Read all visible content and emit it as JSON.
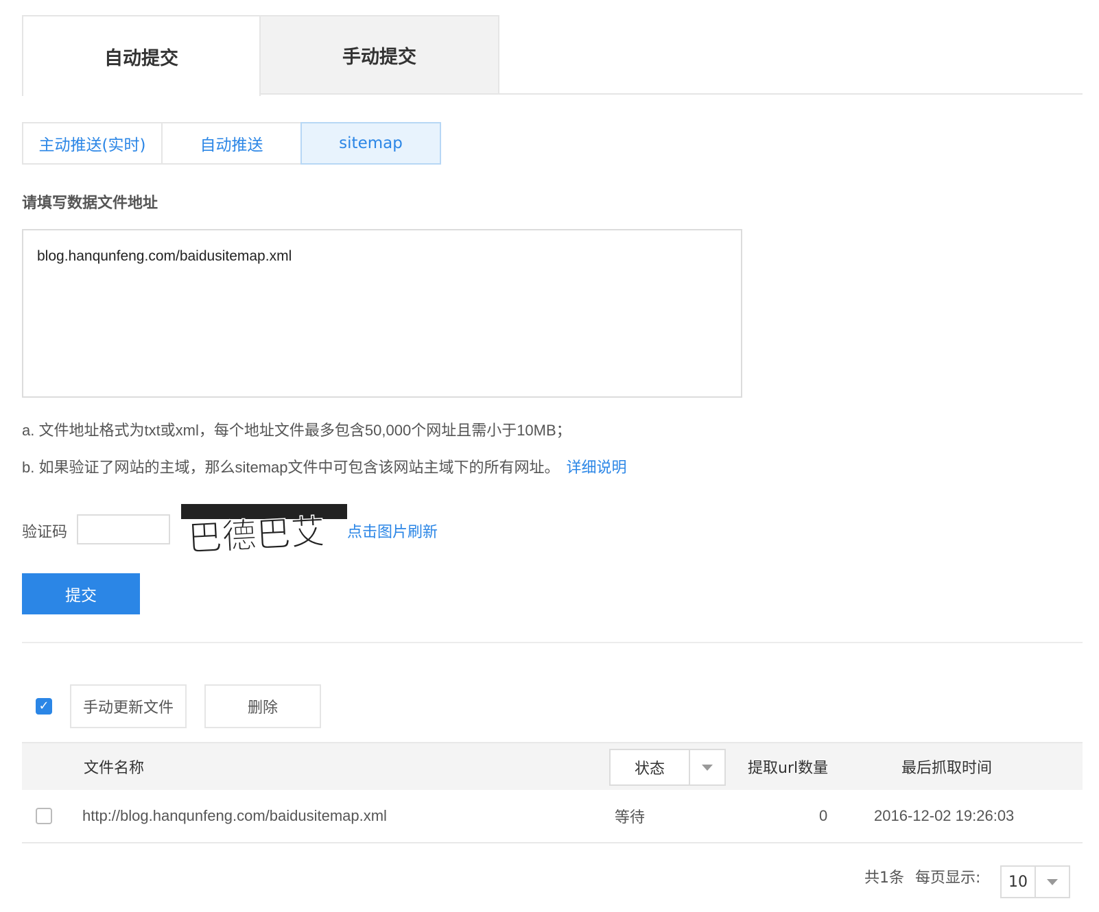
{
  "main_tabs": [
    {
      "label": "自动提交",
      "active": true
    },
    {
      "label": "手动提交",
      "active": false
    }
  ],
  "sub_tabs": [
    {
      "label": "主动推送(实时)",
      "selected": false
    },
    {
      "label": "自动推送",
      "selected": false
    },
    {
      "label": "sitemap",
      "selected": true
    }
  ],
  "form": {
    "field_label": "请填写数据文件地址",
    "url_value": "blog.hanqunfeng.com/baidusitemap.xml",
    "note_a": "a. 文件地址格式为txt或xml，每个地址文件最多包含50,000个网址且需小于10MB；",
    "note_b": "b. 如果验证了网站的主域，那么sitemap文件中可包含该网站主域下的所有网址。",
    "detail_link": "详细说明",
    "captcha_label": "验证码",
    "captcha_value": "",
    "captcha_text": "巴德巴艾",
    "captcha_refresh": "点击图片刷新",
    "submit_label": "提交"
  },
  "toolbar": {
    "select_all_checked": true,
    "update_label": "手动更新文件",
    "delete_label": "删除"
  },
  "table": {
    "headers": {
      "filename": "文件名称",
      "status": "状态",
      "url_count": "提取url数量",
      "last_crawl": "最后抓取时间"
    },
    "rows": [
      {
        "checked": false,
        "filename": "http://blog.hanqunfeng.com/baidusitemap.xml",
        "status": "等待",
        "url_count": "0",
        "last_crawl": "2016-12-02 19:26:03"
      }
    ]
  },
  "pager": {
    "total": "共1条",
    "per_page_label": "每页显示:",
    "per_page_value": "10"
  },
  "colors": {
    "accent": "#2b86e6",
    "selected_tab_bg": "#e8f3fd"
  }
}
